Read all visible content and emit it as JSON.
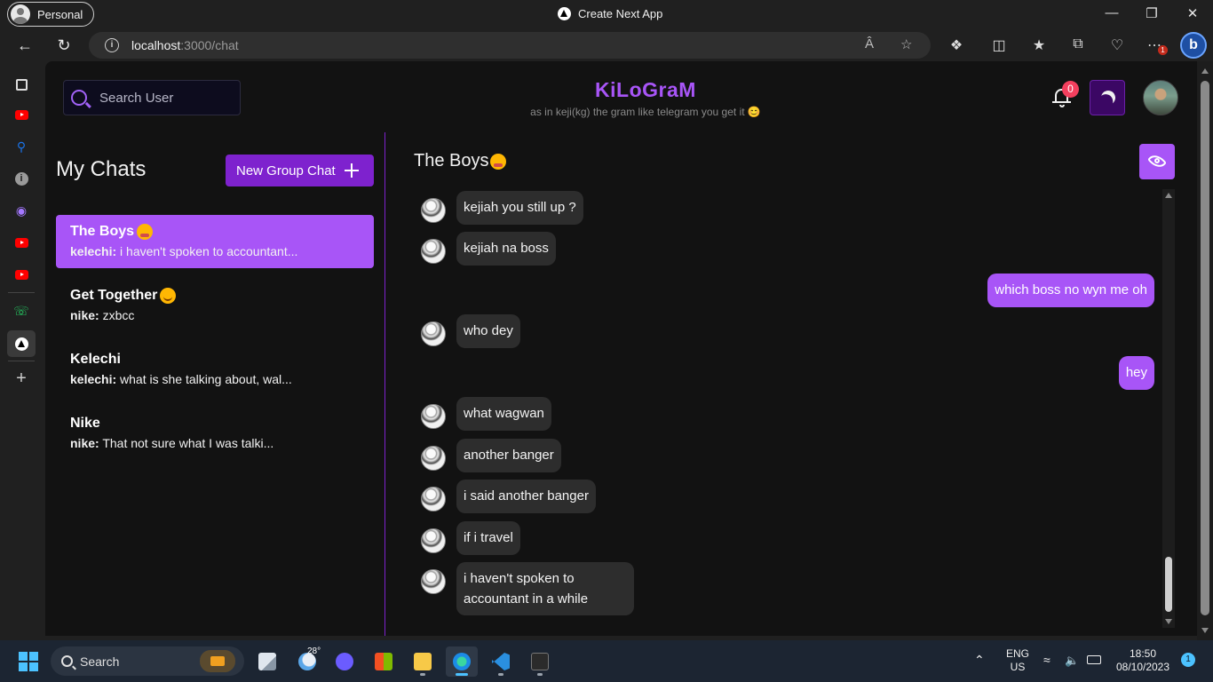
{
  "browser": {
    "profile_label": "Personal",
    "window_title": "Create Next App",
    "url_host": "localhost",
    "url_path": ":3000/chat",
    "extensions_badge": "1"
  },
  "app": {
    "brand": "KiLoGraM",
    "tagline": "as in keji(kg) the gram like telegram you get it 😊",
    "search_placeholder": "Search User",
    "notification_count": "0",
    "accent_color": "#a855f7"
  },
  "chats": {
    "title": "My Chats",
    "new_group_label": "New Group Chat",
    "items": [
      {
        "name": "The Boys",
        "emoji": "flushed",
        "sender": "kelechi:",
        "last": "i haven't spoken to accountant..."
      },
      {
        "name": "Get Together",
        "emoji": "smile",
        "sender": "nike:",
        "last": "zxbcc"
      },
      {
        "name": "Kelechi",
        "emoji": "",
        "sender": "kelechi:",
        "last": "what is she talking about, wal..."
      },
      {
        "name": "Nike",
        "emoji": "",
        "sender": "nike:",
        "last": "That not sure what I was talki..."
      }
    ]
  },
  "conversation": {
    "title": "The Boys",
    "messages": [
      {
        "text": "kejiah you still up ?",
        "mine": false
      },
      {
        "text": "kejiah na boss",
        "mine": false
      },
      {
        "text": "which boss no wyn me oh",
        "mine": true
      },
      {
        "text": "who dey",
        "mine": false
      },
      {
        "text": "hey",
        "mine": true
      },
      {
        "text": "what wagwan",
        "mine": false
      },
      {
        "text": "another banger",
        "mine": false
      },
      {
        "text": "i said another banger",
        "mine": false
      },
      {
        "text": "if i travel",
        "mine": false
      },
      {
        "text": "i haven't spoken to accountant in a while",
        "line1": "i haven't spoken to",
        "line2": "accountant in a while",
        "mine": false
      }
    ]
  },
  "taskbar": {
    "search_label": "Search",
    "weather_temp": "28°",
    "lang_top": "ENG",
    "lang_bottom": "US",
    "time": "18:50",
    "date": "08/10/2023",
    "notification_count": "1"
  }
}
